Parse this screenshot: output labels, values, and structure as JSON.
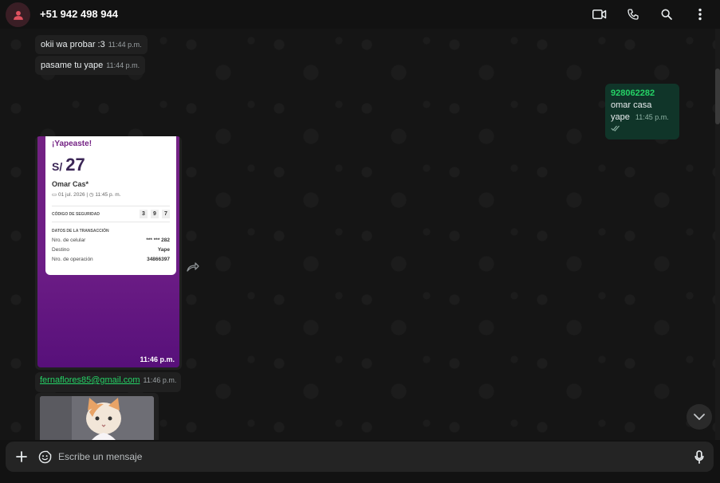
{
  "header": {
    "contact": "+51 942 498 944",
    "icons": [
      "person-icon",
      "video-call-icon",
      "phone-icon",
      "search-icon",
      "more-vertical-icon"
    ]
  },
  "messages": {
    "m1": {
      "text": "okii wa probar :3",
      "time": "11:44 p.m."
    },
    "m2": {
      "text": "pasame tu yape",
      "time": "11:44 p.m."
    },
    "out1": {
      "number": "928062282",
      "line2": "omar casa",
      "line3": "yape",
      "time": "11:45 p.m."
    },
    "receipt": {
      "title": "¡Yapeaste!",
      "currency": "S/",
      "amount": "27",
      "name": "Omar Cas*",
      "date": "01 jul. 2026",
      "time": "11:45 p. m.",
      "security_label": "CÓDIGO DE SEGURIDAD",
      "security_digits": [
        "3",
        "9",
        "7"
      ],
      "section_label": "DATOS DE LA TRANSACCIÓN",
      "rows": [
        {
          "label": "Nro. de celular",
          "value": "*** *** 282"
        },
        {
          "label": "Destino",
          "value": "Yape"
        },
        {
          "label": "Nro. de operación",
          "value": "34866397"
        }
      ],
      "msg_time": "11:46 p.m."
    },
    "link": {
      "text": "fernaflores85@gmail.com",
      "time": "11:46 p.m."
    }
  },
  "composer": {
    "placeholder": "Escribe un mensaje"
  },
  "colors": {
    "accent": "#25d366",
    "outgoing_bubble": "#103529",
    "incoming_bubble": "#202020",
    "yape_purple": "#742284"
  }
}
